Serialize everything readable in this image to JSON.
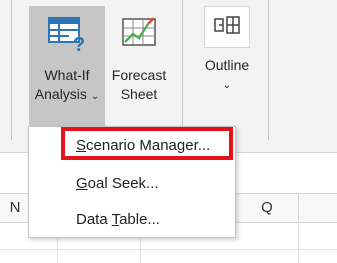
{
  "ribbon": {
    "what_if": {
      "line1": "What-If",
      "line2": "Analysis",
      "chevron": "⌄"
    },
    "forecast": {
      "line1": "Forecast",
      "line2": "Sheet"
    },
    "outline": {
      "label": "Outline",
      "chevron": "⌄"
    }
  },
  "menu": {
    "items": [
      {
        "key": "S",
        "rest": "cenario Manager...",
        "highlighted": true
      },
      {
        "key": "G",
        "rest": "oal Seek..."
      },
      {
        "pre": "Data ",
        "key": "T",
        "rest": "able..."
      }
    ]
  },
  "sheet": {
    "columns": [
      "N",
      "Q"
    ]
  },
  "colors": {
    "highlight_border": "#e8101a",
    "pressed_button": "#c6c6c6",
    "icon_blue": "#2e75b6",
    "icon_green": "#4caf50",
    "icon_red": "#e04a3a"
  }
}
